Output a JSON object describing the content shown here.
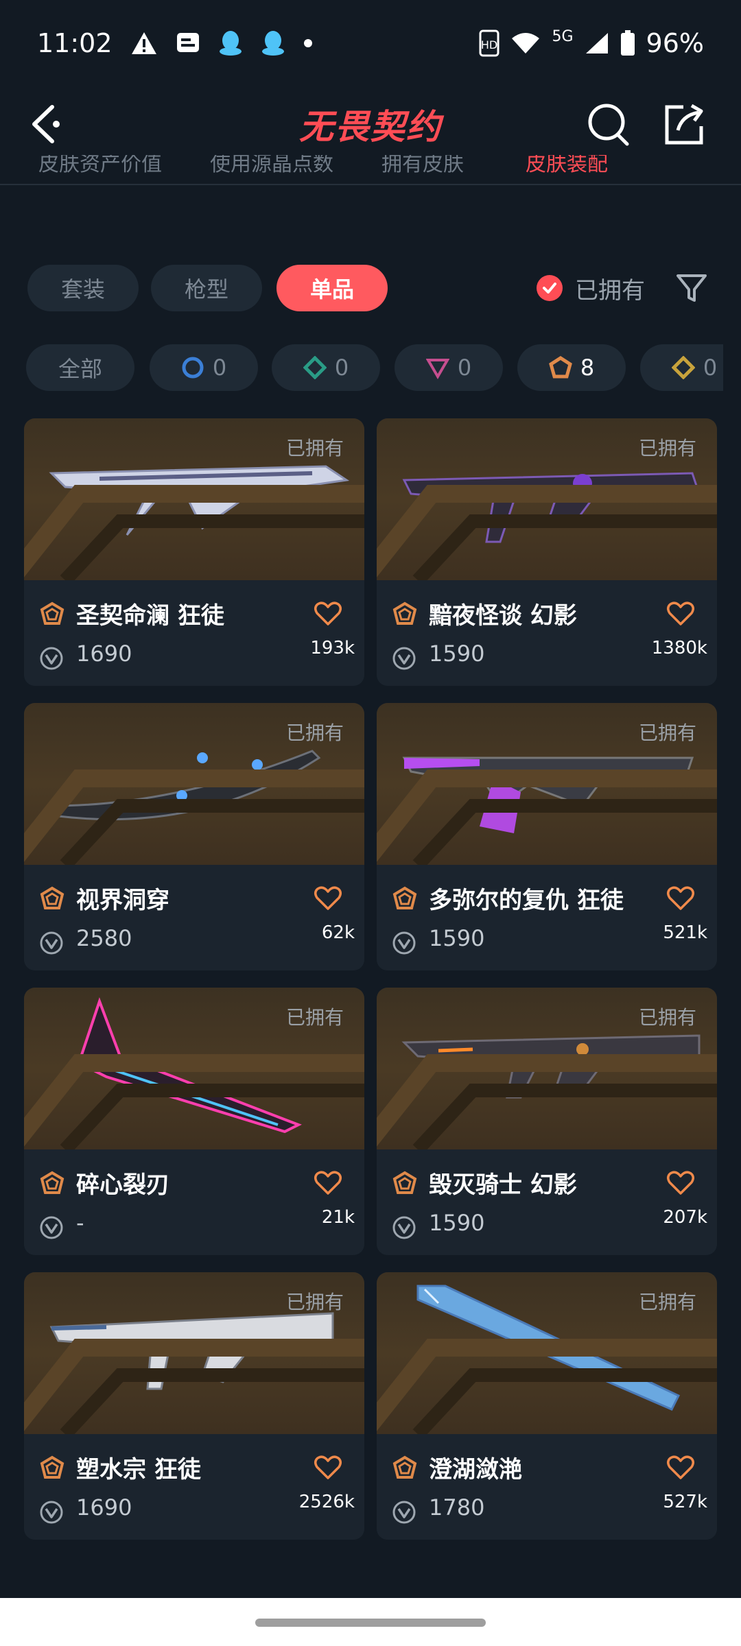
{
  "status_bar": {
    "time": "11:02",
    "network": "5G",
    "battery": "96%"
  },
  "header": {
    "title": "无畏契约"
  },
  "subtabs": [
    "皮肤资产价值",
    "使用源晶点数",
    "拥有皮肤",
    "皮肤装配"
  ],
  "filter_tabs": [
    "套装",
    "枪型",
    "单品"
  ],
  "active_filter": "单品",
  "owned_label": "已拥有",
  "tiers": [
    {
      "label": "全部"
    },
    {
      "count": "0",
      "color": "#3b7fd6"
    },
    {
      "count": "0",
      "color": "#2a9c86"
    },
    {
      "count": "0",
      "color": "#c54e8f"
    },
    {
      "count": "8",
      "color": "#e08a4a"
    },
    {
      "count": "0",
      "color": "#c8a33c"
    }
  ],
  "items": [
    {
      "name": "圣契命澜 狂徒",
      "price": "1690",
      "likes": "193k",
      "owned": "已拥有"
    },
    {
      "name": "黯夜怪谈 幻影",
      "price": "1590",
      "likes": "1380k",
      "owned": "已拥有"
    },
    {
      "name": "视界洞穿",
      "price": "2580",
      "likes": "62k",
      "owned": "已拥有"
    },
    {
      "name": "多弥尔的复仇 狂徒",
      "price": "1590",
      "likes": "521k",
      "owned": "已拥有"
    },
    {
      "name": "碎心裂刃",
      "price": "-",
      "likes": "21k",
      "owned": "已拥有"
    },
    {
      "name": "毁灭骑士 幻影",
      "price": "1590",
      "likes": "207k",
      "owned": "已拥有"
    },
    {
      "name": "塑水宗 狂徒",
      "price": "1690",
      "likes": "2526k",
      "owned": "已拥有"
    },
    {
      "name": "澄湖潋滟",
      "price": "1780",
      "likes": "527k",
      "owned": "已拥有"
    }
  ]
}
